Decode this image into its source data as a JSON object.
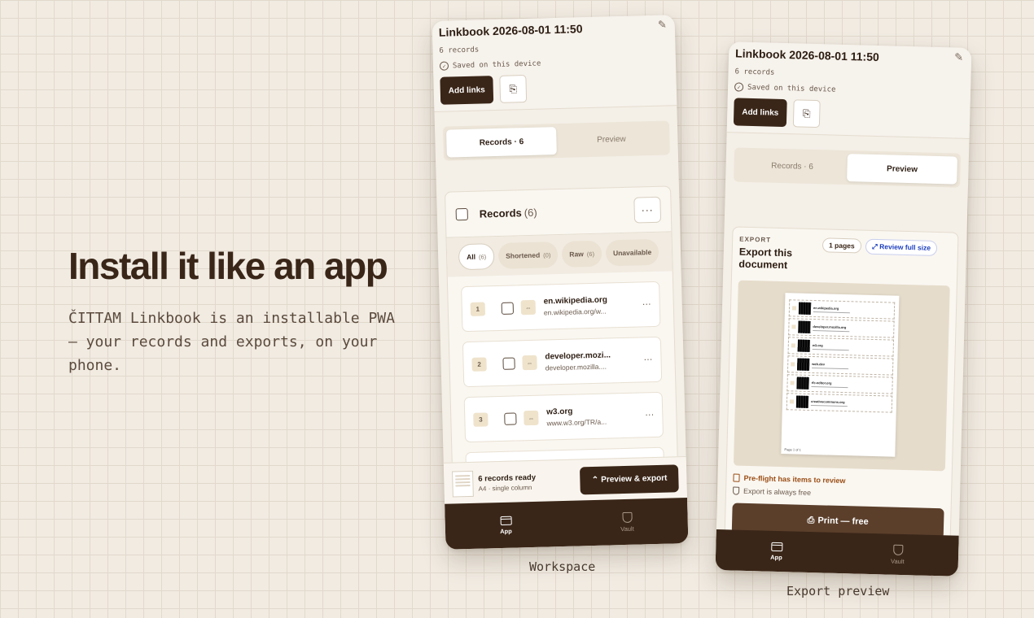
{
  "hero": {
    "title": "Install it like an app",
    "subtitle": "ČITTAM Linkbook is an installable PWA — your records and exports, on your phone."
  },
  "captions": {
    "workspace": "Workspace",
    "export": "Export preview"
  },
  "phone": {
    "title": "Linkbook 2026-08-01 11:50",
    "count": "6 records",
    "saved": "Saved on this device",
    "add_links": "Add links",
    "tabs": {
      "records": "Records · 6",
      "preview": "Preview"
    }
  },
  "records": {
    "title": "Records",
    "count": "(6)",
    "filters": [
      {
        "label": "All",
        "count": "(6)"
      },
      {
        "label": "Shortened",
        "count": "(0)"
      },
      {
        "label": "Raw",
        "count": "(6)"
      },
      {
        "label": "Unavailable",
        "count": ""
      }
    ],
    "rows": [
      {
        "idx": "1",
        "domain": "en.wikipedia.org",
        "url": "en.wikipedia.org/w..."
      },
      {
        "idx": "2",
        "domain": "developer.mozi...",
        "url": "developer.mozilla...."
      },
      {
        "idx": "3",
        "domain": "w3.org",
        "url": "www.w3.org/TR/a..."
      }
    ]
  },
  "ready": {
    "title": "6 records ready",
    "sub": "A4 · single column",
    "button": "Preview & export"
  },
  "nav": {
    "app": "App",
    "vault": "Vault"
  },
  "export": {
    "label": "EXPORT",
    "title": "Export this document",
    "pages": "1 pages",
    "full_size": "Review full size",
    "preflight": "Pre-flight has items to review",
    "always_free": "Export is always free",
    "print": "Print — free",
    "page_footer": "Page 1 of 1",
    "mini_rows": [
      "en.wikipedia.org",
      "developer.mozilla.org",
      "w3.org",
      "web.dev",
      "rfc-editor.org",
      "creativecommons.org"
    ]
  },
  "icons": [
    "pencil-icon",
    "check-circle-icon",
    "clipboard-icon",
    "chevron-up-icon",
    "link-icon",
    "more-icon",
    "app-icon",
    "shield-icon",
    "expand-icon",
    "document-icon",
    "printer-icon"
  ],
  "colors": {
    "primary": "#3a2618",
    "background": "#f1ebe2",
    "link": "#1e3fbf",
    "warning": "#9a4d14"
  }
}
